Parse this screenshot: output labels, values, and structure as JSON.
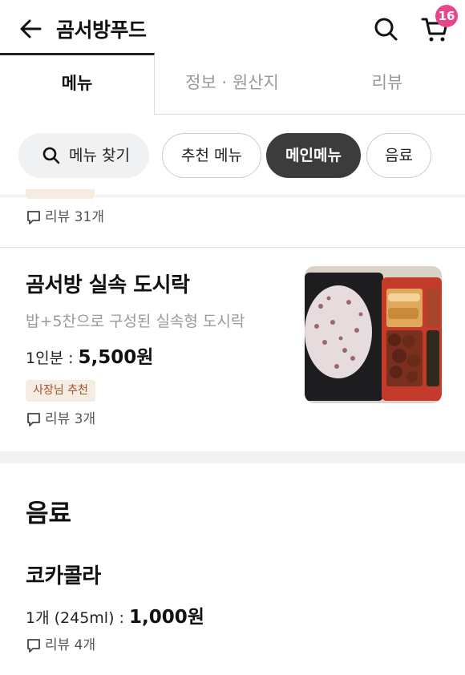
{
  "header": {
    "store_name": "곰서방푸드",
    "cart_count": "16"
  },
  "tabs": [
    {
      "label": "메뉴",
      "active": true
    },
    {
      "label": "정보 · 원산지",
      "active": false
    },
    {
      "label": "리뷰",
      "active": false
    }
  ],
  "chips": {
    "search_label": "메뉴 찾기",
    "items": [
      {
        "label": "추천 메뉴",
        "selected": false
      },
      {
        "label": "메인메뉴",
        "selected": true
      },
      {
        "label": "음료",
        "selected": false
      }
    ]
  },
  "partial_item": {
    "review_text": "리뷰 31개"
  },
  "menu_item": {
    "name": "곰서방 실속 도시락",
    "description": "밥+5찬으로 구성된 실속형 도시락",
    "price_label": "1인분 : ",
    "price_value": "5,500원",
    "badge": "사장님 추천",
    "review_text": "리뷰 3개"
  },
  "drinks_section": {
    "title": "음료",
    "items": [
      {
        "name": "코카콜라",
        "price_label": "1개 (245ml) : ",
        "price_value": "1,000원",
        "review_text": "리뷰 4개"
      }
    ]
  },
  "colors": {
    "badge_pink": "#e8458b",
    "chip_selected_bg": "#3c3c3c",
    "owner_badge_bg": "#f7ece1",
    "owner_badge_text": "#a0522d"
  }
}
